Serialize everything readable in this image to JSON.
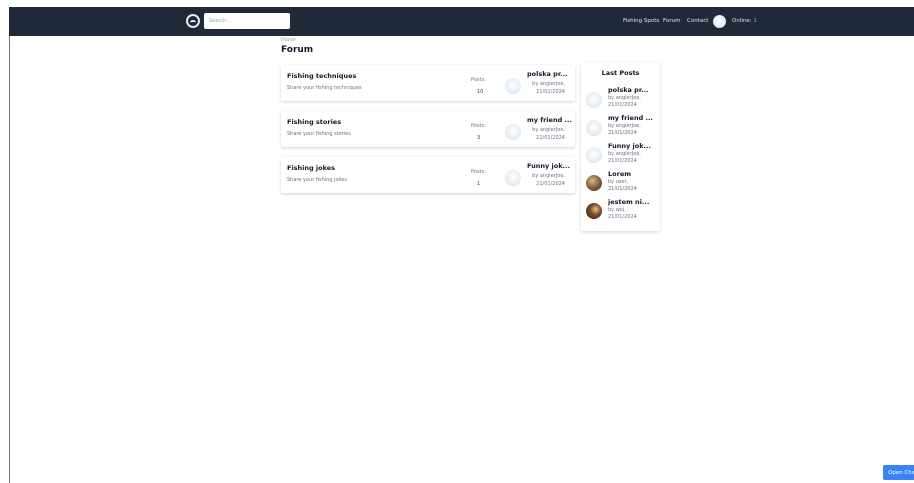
{
  "header": {
    "search_placeholder": "Search...",
    "nav": {
      "fishing_spots": "Fishing Spots",
      "forum": "Forum",
      "contact": "Contact"
    },
    "online_label": "Online:",
    "online_count": "1"
  },
  "breadcrumb": "Home",
  "page_title": "Forum",
  "forums": [
    {
      "title": "Fishing techniques",
      "description": "Share your fishing techniques",
      "posts_label": "Posts:",
      "posts_count": "10",
      "last_post": {
        "title": "polska pr...",
        "by": "by anglerJoe,",
        "date": "21/01/2024",
        "avatar": "default-avatar"
      }
    },
    {
      "title": "Fishing stories",
      "description": "Share your fishing stories",
      "posts_label": "Posts:",
      "posts_count": "3",
      "last_post": {
        "title": "my friend ...",
        "by": "by anglerJoe,",
        "date": "21/01/2024",
        "avatar": "default-avatar"
      }
    },
    {
      "title": "Fishing jokes",
      "description": "Share your fishing jokes",
      "posts_label": "Posts:",
      "posts_count": "1",
      "last_post": {
        "title": "Funny jok...",
        "by": "by anglerJoe,",
        "date": "21/01/2024",
        "avatar": "default-avatar"
      }
    }
  ],
  "last_posts": {
    "heading": "Last Posts",
    "items": [
      {
        "title": "polska pr...",
        "by": "by anglerJoe,",
        "date": "21/01/2024",
        "avatar": "default-avatar"
      },
      {
        "title": "my friend ...",
        "by": "by anglerJoe,",
        "date": "21/01/2024",
        "avatar": "default-avatar"
      },
      {
        "title": "Funny jok...",
        "by": "by anglerJoe,",
        "date": "21/01/2024",
        "avatar": "default-avatar"
      },
      {
        "title": "Lorem",
        "by": "by user,",
        "date": "21/01/2024",
        "avatar": "photo-avatar"
      },
      {
        "title": "jestem ni...",
        "by": "by woj,",
        "date": "21/01/2024",
        "avatar": "photo-avatar"
      }
    ]
  },
  "chat": {
    "button_label": "Open Chat"
  },
  "colors": {
    "navbar": "#1f2937",
    "accent": "#3b82f6"
  },
  "icons": {
    "logo": "fish-logo-icon",
    "user": "user-avatar-icon"
  }
}
